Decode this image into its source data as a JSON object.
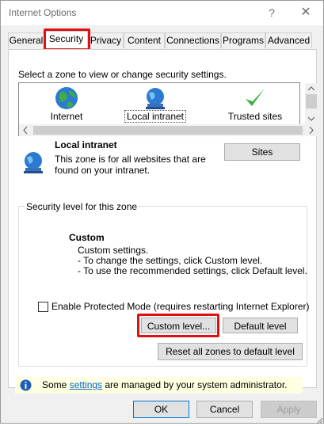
{
  "window": {
    "title": "Internet Options",
    "help_glyph": "?",
    "close_glyph": "✕"
  },
  "tabs": [
    {
      "label": "General"
    },
    {
      "label": "Security",
      "active": true
    },
    {
      "label": "Privacy"
    },
    {
      "label": "Content"
    },
    {
      "label": "Connections"
    },
    {
      "label": "Programs"
    },
    {
      "label": "Advanced"
    }
  ],
  "security": {
    "zone_prompt": "Select a zone to view or change security settings.",
    "zones": [
      {
        "label": "Internet",
        "icon": "globe-icon"
      },
      {
        "label": "Local intranet",
        "icon": "intranet-globe-icon",
        "selected": true
      },
      {
        "label": "Trusted sites",
        "icon": "checkmark-icon"
      }
    ],
    "selected_zone": {
      "title": "Local intranet",
      "description_line1": "This zone is for all websites that are",
      "description_line2": "found on your intranet.",
      "sites_button": "Sites"
    },
    "level_group": {
      "title": "Security level for this zone",
      "level_title": "Custom",
      "line1": "Custom settings.",
      "line2": "- To change the settings, click Custom level.",
      "line3": "- To use the recommended settings, click Default level."
    },
    "protected_mode_label": "Enable Protected Mode (requires restarting Internet Explorer)",
    "protected_mode_checked": false,
    "custom_level_button": "Custom level...",
    "default_level_button": "Default level",
    "reset_all_button": "Reset all zones to default level",
    "info": {
      "prefix": "Some ",
      "link": "settings",
      "suffix": " are managed by your system administrator."
    }
  },
  "footer": {
    "ok": "OK",
    "cancel": "Cancel",
    "apply": "Apply"
  },
  "colors": {
    "highlight": "#e01010",
    "info_background": "#ffffe1",
    "link": "#0066cc"
  }
}
